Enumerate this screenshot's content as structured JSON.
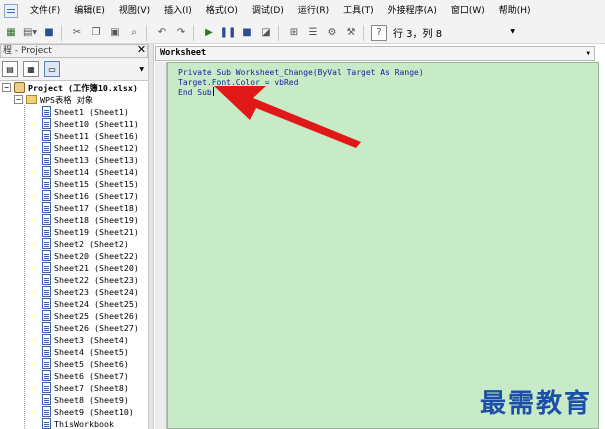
{
  "menu": [
    "文件(F)",
    "编辑(E)",
    "视图(V)",
    "插入(I)",
    "格式(O)",
    "调试(D)",
    "运行(R)",
    "工具(T)",
    "外接程序(A)",
    "窗口(W)",
    "帮助(H)"
  ],
  "toolbar": {
    "status": "行 3，列 8",
    "icons": [
      "excel-view-icon",
      "insert-module-icon",
      "save-icon",
      "cut-icon",
      "copy-icon",
      "paste-icon",
      "find-icon",
      "undo-icon",
      "redo-icon",
      "run-icon",
      "break-icon",
      "reset-icon",
      "design-mode-icon",
      "project-explorer-icon",
      "properties-icon",
      "object-browser-icon",
      "toolbox-icon",
      "help-icon"
    ]
  },
  "project_panel": {
    "title": "程 - Project",
    "close": "✕"
  },
  "tree": {
    "root": "Project (工作簿10.xlsx)",
    "folder": "WPS表格 对象",
    "items": [
      "Sheet1 (Sheet1)",
      "Sheet10 (Sheet11)",
      "Sheet11 (Sheet16)",
      "Sheet12 (Sheet12)",
      "Sheet13 (Sheet13)",
      "Sheet14 (Sheet14)",
      "Sheet15 (Sheet15)",
      "Sheet16 (Sheet17)",
      "Sheet17 (Sheet18)",
      "Sheet18 (Sheet19)",
      "Sheet19 (Sheet21)",
      "Sheet2 (Sheet2)",
      "Sheet20 (Sheet22)",
      "Sheet21 (Sheet20)",
      "Sheet22 (Sheet23)",
      "Sheet23 (Sheet24)",
      "Sheet24 (Sheet25)",
      "Sheet25 (Sheet26)",
      "Sheet26 (Sheet27)",
      "Sheet3 (Sheet4)",
      "Sheet4 (Sheet5)",
      "Sheet5 (Sheet6)",
      "Sheet6 (Sheet7)",
      "Sheet7 (Sheet8)",
      "Sheet8 (Sheet9)",
      "Sheet9 (Sheet10)",
      "ThisWorkbook"
    ]
  },
  "code": {
    "object_dropdown": "Worksheet",
    "lines": [
      "Private Sub Worksheet_Change(ByVal Target As Range)",
      "Target.Font.Color = vbRed",
      "End Sub"
    ]
  },
  "annotation_color": "#e01818",
  "code_background": "#c7ebc7",
  "watermark": "最需教育"
}
